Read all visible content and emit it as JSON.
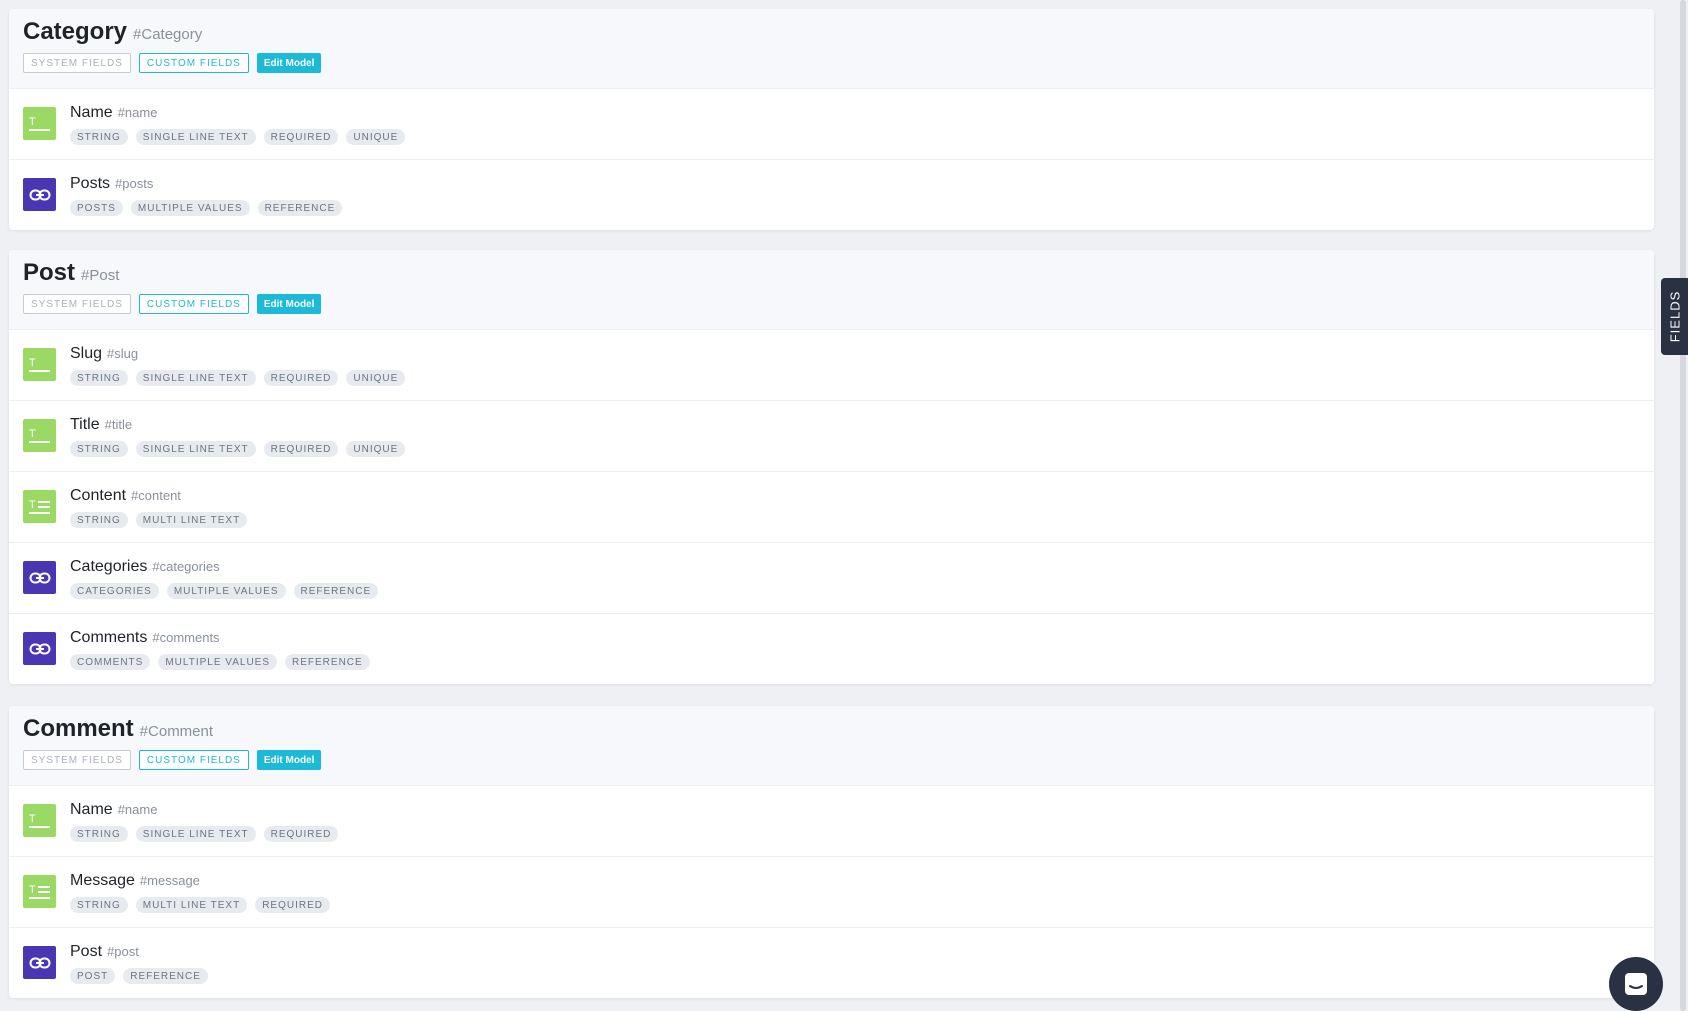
{
  "side_tab": {
    "label": "FIELDS"
  },
  "model_labels": {
    "system_fields": "SYSTEM FIELDS",
    "custom_fields": "CUSTOM FIELDS",
    "edit_model": "Edit Model"
  },
  "models": [
    {
      "name": "Category",
      "api_id": "#Category",
      "fields": [
        {
          "name": "Name",
          "api_id": "#name",
          "icon": "single-line-text-icon",
          "tags": [
            "STRING",
            "SINGLE LINE TEXT",
            "REQUIRED",
            "UNIQUE"
          ]
        },
        {
          "name": "Posts",
          "api_id": "#posts",
          "icon": "reference-link-icon",
          "tags": [
            "POSTS",
            "MULTIPLE VALUES",
            "REFERENCE"
          ]
        }
      ]
    },
    {
      "name": "Post",
      "api_id": "#Post",
      "fields": [
        {
          "name": "Slug",
          "api_id": "#slug",
          "icon": "single-line-text-icon",
          "tags": [
            "STRING",
            "SINGLE LINE TEXT",
            "REQUIRED",
            "UNIQUE"
          ]
        },
        {
          "name": "Title",
          "api_id": "#title",
          "icon": "single-line-text-icon",
          "tags": [
            "STRING",
            "SINGLE LINE TEXT",
            "REQUIRED",
            "UNIQUE"
          ]
        },
        {
          "name": "Content",
          "api_id": "#content",
          "icon": "multi-line-text-icon",
          "tags": [
            "STRING",
            "MULTI LINE TEXT"
          ]
        },
        {
          "name": "Categories",
          "api_id": "#categories",
          "icon": "reference-link-icon",
          "tags": [
            "CATEGORIES",
            "MULTIPLE VALUES",
            "REFERENCE"
          ]
        },
        {
          "name": "Comments",
          "api_id": "#comments",
          "icon": "reference-link-icon",
          "tags": [
            "COMMENTS",
            "MULTIPLE VALUES",
            "REFERENCE"
          ]
        }
      ]
    },
    {
      "name": "Comment",
      "api_id": "#Comment",
      "fields": [
        {
          "name": "Name",
          "api_id": "#name",
          "icon": "single-line-text-icon",
          "tags": [
            "STRING",
            "SINGLE LINE TEXT",
            "REQUIRED"
          ]
        },
        {
          "name": "Message",
          "api_id": "#message",
          "icon": "multi-line-text-icon",
          "tags": [
            "STRING",
            "MULTI LINE TEXT",
            "REQUIRED"
          ]
        },
        {
          "name": "Post",
          "api_id": "#post",
          "icon": "reference-link-icon",
          "tags": [
            "POST",
            "REFERENCE"
          ]
        }
      ]
    }
  ],
  "colors": {
    "text_field_icon_bg": "#9ad964",
    "reference_icon_bg": "#4a35b3",
    "accent": "#1cbad6",
    "side_tab_bg": "#2a3142"
  },
  "chat_widget": {
    "icon": "chat-bubble-icon"
  }
}
